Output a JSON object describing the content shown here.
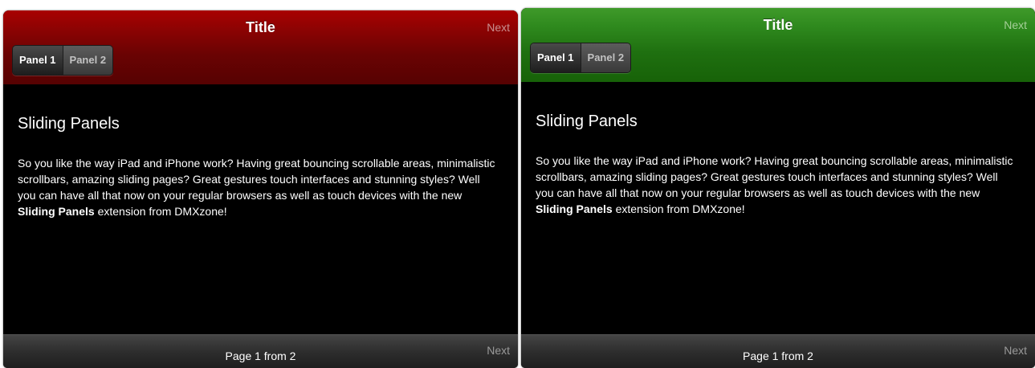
{
  "widgets": [
    {
      "theme": "red",
      "accent_color": "#8e0303",
      "header": {
        "title": "Title",
        "next_label": "Next"
      },
      "tabs": [
        {
          "label": "Panel 1",
          "active": true
        },
        {
          "label": "Panel 2",
          "active": false
        }
      ],
      "content": {
        "heading": "Sliding Panels",
        "text_before": "So you like the way iPad and iPhone work? Having great bouncing scrollable areas, minimalistic scrollbars, amazing sliding pages? Great gestures touch interfaces and stunning styles? Well you can have all that now on your regular browsers as well as touch devices with the new ",
        "text_bold": "Sliding Panels",
        "text_after": " extension from DMXzone!"
      },
      "footer": {
        "status": "Page 1 from 2",
        "next_label": "Next"
      }
    },
    {
      "theme": "green",
      "accent_color": "#2f8a1e",
      "header": {
        "title": "Title",
        "next_label": "Next"
      },
      "tabs": [
        {
          "label": "Panel 1",
          "active": true
        },
        {
          "label": "Panel 2",
          "active": false
        }
      ],
      "content": {
        "heading": "Sliding Panels",
        "text_before": "So you like the way iPad and iPhone work? Having great bouncing scrollable areas, minimalistic scrollbars, amazing sliding pages? Great gestures touch interfaces and stunning styles? Well you can have all that now on your regular browsers as well as touch devices with the new ",
        "text_bold": "Sliding Panels",
        "text_after": " extension from DMXzone!"
      },
      "footer": {
        "status": "Page 1 from 2",
        "next_label": "Next"
      }
    }
  ]
}
